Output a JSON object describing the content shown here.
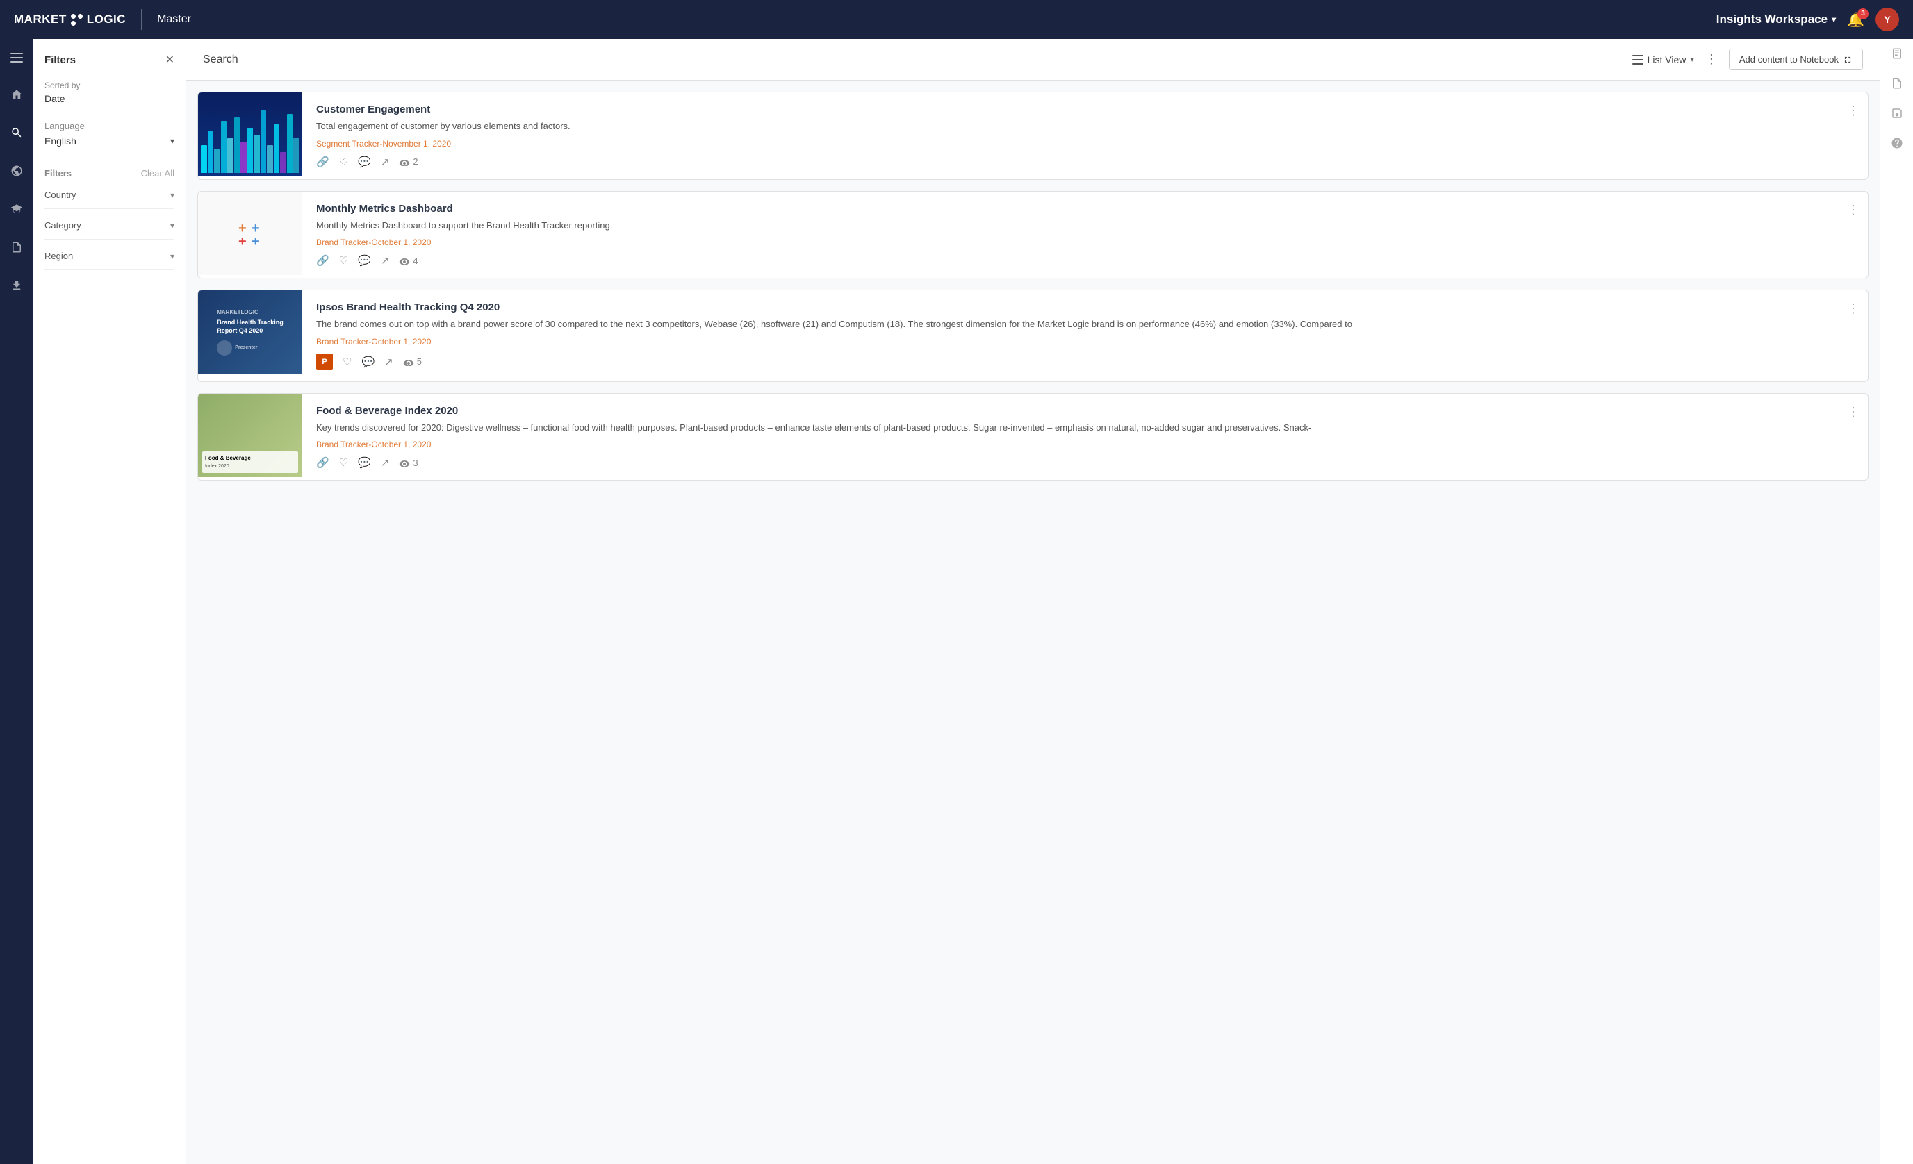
{
  "app": {
    "logo": "MARKETLOGIC",
    "nav_title": "Master",
    "workspace_label": "Insights Workspace",
    "notif_count": "3"
  },
  "header": {
    "search_title": "Search",
    "list_view_label": "List View",
    "add_notebook_label": "Add content to Notebook"
  },
  "filters": {
    "title": "Filters",
    "sorted_by_label": "Sorted by",
    "sorted_by_value": "Date",
    "language_label": "Language",
    "language_value": "English",
    "filters_label": "Filters",
    "clear_all_label": "Clear All",
    "country_label": "Country",
    "category_label": "Category",
    "region_label": "Region"
  },
  "results": [
    {
      "id": 1,
      "title": "Customer Engagement",
      "description": "Total engagement of customer by various elements and factors.",
      "meta": "Segment Tracker-November 1, 2020",
      "views": "2",
      "thumb_type": "chart",
      "file_type": "link"
    },
    {
      "id": 2,
      "title": "Monthly Metrics Dashboard",
      "description": "Monthly Metrics Dashboard to support the Brand Health Tracker reporting.",
      "meta": "Brand Tracker-October 1, 2020",
      "views": "4",
      "thumb_type": "cross",
      "file_type": "link"
    },
    {
      "id": 3,
      "title": "Ipsos Brand Health Tracking Q4 2020",
      "description": "The brand comes out on top with a brand power score of 30 compared to the next 3 competitors, Webase (26), hsoftware (21) and Computism (18). The strongest dimension for the Market Logic brand is on performance (46%) and emotion (33%). Compared to",
      "meta": "Brand Tracker-October 1, 2020",
      "views": "5",
      "thumb_type": "brand",
      "file_type": "ppt"
    },
    {
      "id": 4,
      "title": "Food & Beverage Index 2020",
      "description": "Key trends discovered for 2020: Digestive wellness – functional food with health purposes. Plant-based products – enhance taste elements of plant-based products. Sugar re-invented – emphasis on natural, no-added sugar and preservatives. Snack-",
      "meta": "Brand Tracker-October 1, 2020",
      "views": "3",
      "thumb_type": "food",
      "file_type": "link"
    }
  ],
  "sidebar_icons": {
    "home": "🏠",
    "search": "🔍",
    "globe": "🌐",
    "book": "📚",
    "report": "📋",
    "upload": "⬆"
  },
  "right_panel_icons": {
    "notebook": "📓",
    "document": "📄",
    "save": "💾",
    "help": "❓"
  }
}
